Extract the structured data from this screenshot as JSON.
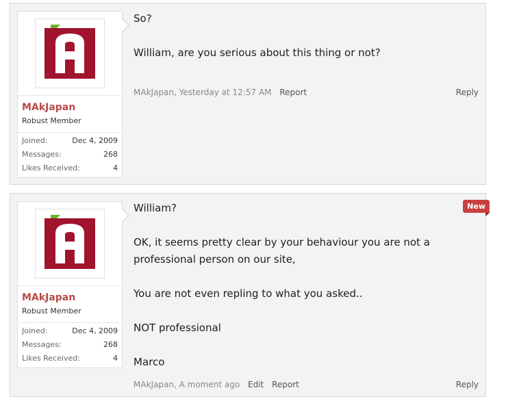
{
  "posts": [
    {
      "username": "MAkJapan",
      "user_title": "Robust Member",
      "stats": [
        {
          "label": "Joined:",
          "value": "Dec 4, 2009"
        },
        {
          "label": "Messages:",
          "value": "268"
        },
        {
          "label": "Likes Received:",
          "value": "4"
        }
      ],
      "message": [
        "So?",
        "William, are you serious about this thing or not?"
      ],
      "meta_author": "MAkJapan, Yesterday at 12:57 AM",
      "report_label": "Report",
      "reply_label": "Reply"
    },
    {
      "username": "MAkJapan",
      "user_title": "Robust Member",
      "stats": [
        {
          "label": "Joined:",
          "value": "Dec 4, 2009"
        },
        {
          "label": "Messages:",
          "value": "268"
        },
        {
          "label": "Likes Received:",
          "value": "4"
        }
      ],
      "badge": "New",
      "message": [
        "William?",
        "OK, it seems pretty clear by your behaviour you are not a",
        "professional person on our site,",
        "You are not even repling to what you asked..",
        "NOT professional",
        "Marco"
      ],
      "meta_author": "MAkJapan, A moment ago",
      "edit_label": "Edit",
      "report_label": "Report",
      "reply_label": "Reply"
    }
  ],
  "colors": {
    "username": "#b94a48",
    "badge": "#c9403e",
    "avatar": "#a0142e",
    "corner": "#6cb12a"
  }
}
